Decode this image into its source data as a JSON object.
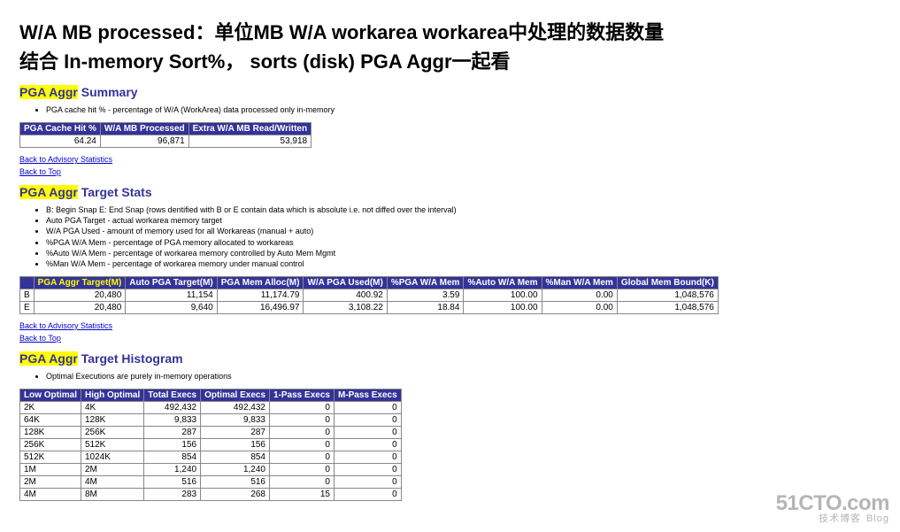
{
  "titleLine1": "W/A MB processed：单位MB  W/A workarea  workarea中处理的数据数量",
  "titleLine2": "结合 In-memory Sort%， sorts (disk) PGA Aggr一起看",
  "watermark": {
    "line1": "51CTO.com",
    "line2a": "技术博客",
    "line2b": "Blog"
  },
  "backAdv": "Back to Advisory Statistics",
  "backTop": "Back to Top",
  "summary": {
    "heading_pre": "PGA Aggr",
    "heading_post": " Summary",
    "notes": [
      "PGA cache hit % - percentage of W/A (WorkArea) data processed only in-memory"
    ],
    "headers": [
      "PGA Cache Hit %",
      "W/A MB Processed",
      "Extra W/A MB Read/Written"
    ],
    "rows": [
      [
        "64.24",
        "96,871",
        "53,918"
      ]
    ]
  },
  "targetStats": {
    "heading_pre": "PGA Aggr",
    "heading_post": " Target Stats",
    "notes": [
      "B: Begin Snap E: End Snap (rows dentified with B or E contain data which is absolute i.e. not diffed over the interval)",
      "Auto PGA Target - actual workarea memory target",
      "W/A PGA Used - amount of memory used for all Workareas (manual + auto)",
      "%PGA W/A Mem - percentage of PGA memory allocated to workareas",
      "%Auto W/A Mem - percentage of workarea memory controlled by Auto Mem Mgmt",
      "%Man W/A Mem - percentage of workarea memory under manual control"
    ],
    "headers": [
      "PGA Aggr Target(M)",
      "Auto PGA Target(M)",
      "PGA Mem Alloc(M)",
      "W/A PGA Used(M)",
      "%PGA W/A Mem",
      "%Auto W/A Mem",
      "%Man W/A Mem",
      "Global Mem Bound(K)"
    ],
    "rowLabels": [
      "B",
      "E"
    ],
    "rows": [
      [
        "20,480",
        "11,154",
        "11,174.79",
        "400.92",
        "3.59",
        "100.00",
        "0.00",
        "1,048,576"
      ],
      [
        "20,480",
        "9,640",
        "16,496.97",
        "3,108.22",
        "18.84",
        "100.00",
        "0.00",
        "1,048,576"
      ]
    ]
  },
  "histogram": {
    "heading_pre": "PGA Aggr",
    "heading_post": " Target Histogram",
    "notes": [
      "Optimal Executions are purely in-memory operations"
    ],
    "headers": [
      "Low Optimal",
      "High Optimal",
      "Total Execs",
      "Optimal Execs",
      "1-Pass Execs",
      "M-Pass Execs"
    ],
    "rows": [
      [
        "2K",
        "4K",
        "492,432",
        "492,432",
        "0",
        "0"
      ],
      [
        "64K",
        "128K",
        "9,833",
        "9,833",
        "0",
        "0"
      ],
      [
        "128K",
        "256K",
        "287",
        "287",
        "0",
        "0"
      ],
      [
        "256K",
        "512K",
        "156",
        "156",
        "0",
        "0"
      ],
      [
        "512K",
        "1024K",
        "854",
        "854",
        "0",
        "0"
      ],
      [
        "1M",
        "2M",
        "1,240",
        "1,240",
        "0",
        "0"
      ],
      [
        "2M",
        "4M",
        "516",
        "516",
        "0",
        "0"
      ],
      [
        "4M",
        "8M",
        "283",
        "268",
        "15",
        "0"
      ]
    ]
  }
}
